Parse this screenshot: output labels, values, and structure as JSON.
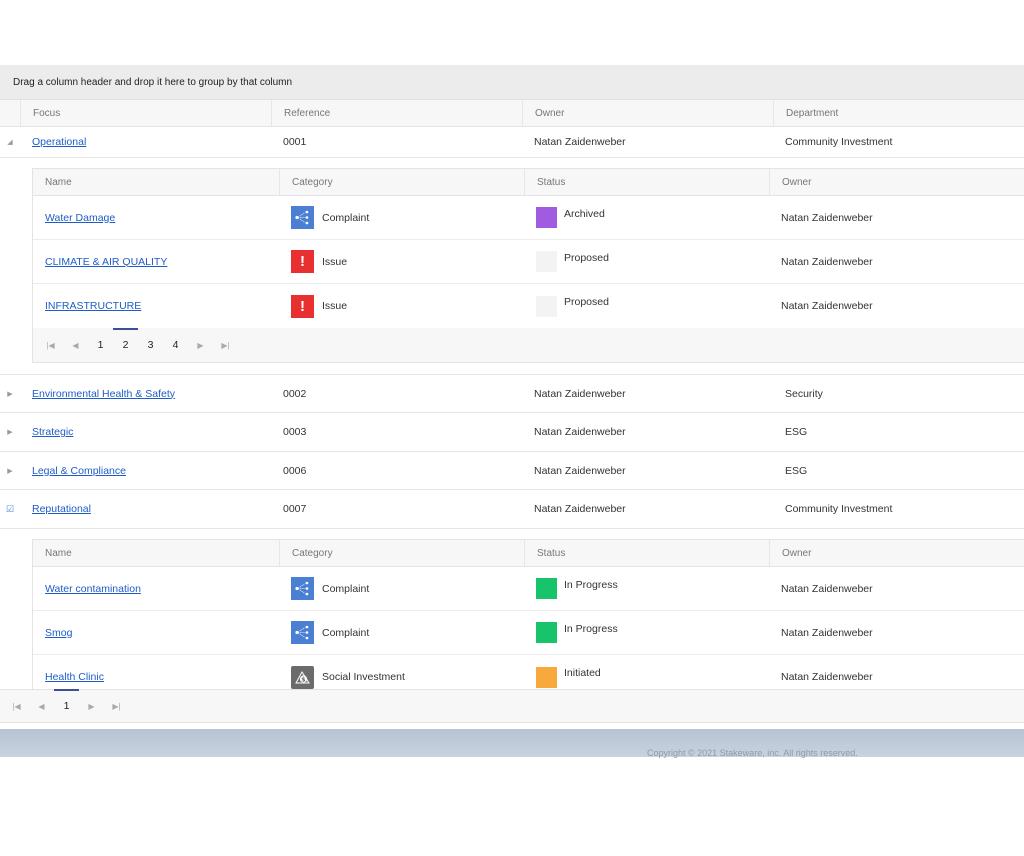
{
  "group_panel_text": "Drag a column header and drop it here to group by that column",
  "columns": {
    "focus": "Focus",
    "reference": "Reference",
    "owner": "Owner",
    "department": "Department"
  },
  "detail_columns": {
    "name": "Name",
    "category": "Category",
    "status": "Status",
    "owner": "Owner"
  },
  "groups": [
    {
      "focus": "Operational",
      "reference": "0001",
      "owner": "Natan Zaidenweber",
      "department": "Community Investment",
      "expanded": true,
      "items": [
        {
          "name": "Water Damage",
          "category": "Complaint",
          "category_icon": "complaint-icon",
          "status": "Archived",
          "status_color": "#a05be0",
          "owner": "Natan Zaidenweber"
        },
        {
          "name": "CLIMATE & AIR QUALITY",
          "category": "Issue",
          "category_icon": "issue-icon",
          "status": "Proposed",
          "status_color": "#f3f3f3",
          "owner": "Natan Zaidenweber"
        },
        {
          "name": "INFRASTRUCTURE",
          "category": "Issue",
          "category_icon": "issue-icon",
          "status": "Proposed",
          "status_color": "#f3f3f3",
          "owner": "Natan Zaidenweber"
        }
      ],
      "pages": [
        "1",
        "2",
        "3",
        "4"
      ],
      "active_page": "2"
    },
    {
      "focus": "Environmental Health & Safety",
      "reference": "0002",
      "owner": "Natan Zaidenweber",
      "department": "Security",
      "expanded": false
    },
    {
      "focus": "Strategic",
      "reference": "0003",
      "owner": "Natan Zaidenweber",
      "department": "ESG",
      "expanded": false
    },
    {
      "focus": "Legal & Compliance",
      "reference": "0006",
      "owner": "Natan Zaidenweber",
      "department": "ESG",
      "expanded": false
    },
    {
      "focus": "Reputational",
      "reference": "0007",
      "owner": "Natan Zaidenweber",
      "department": "Community Investment",
      "expanded": true,
      "items": [
        {
          "name": "Water contamination",
          "category": "Complaint",
          "category_icon": "complaint-icon",
          "status": "In Progress",
          "status_color": "#17c46b",
          "owner": "Natan Zaidenweber"
        },
        {
          "name": "Smog",
          "category": "Complaint",
          "category_icon": "complaint-icon",
          "status": "In Progress",
          "status_color": "#17c46b",
          "owner": "Natan Zaidenweber"
        },
        {
          "name": "Health Clinic",
          "category": "Social Investment",
          "category_icon": "social-investment-icon",
          "status": "Initiated",
          "status_color": "#f7a93b",
          "owner": "Natan Zaidenweber"
        }
      ]
    }
  ],
  "main_pager": {
    "pages": [
      "1"
    ],
    "active_page": "1"
  },
  "copyright": "Copyright © 2021 Stakeware, inc. All rights reserved."
}
